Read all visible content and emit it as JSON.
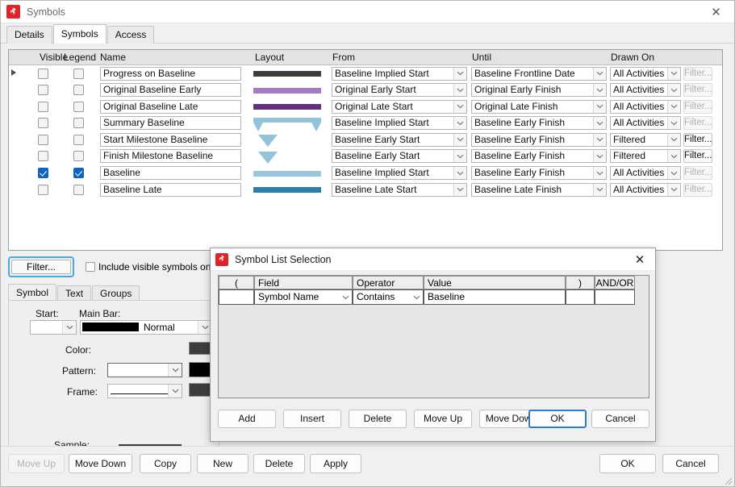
{
  "window": {
    "title": "Symbols",
    "icon": "app-logo-icon",
    "close_label": "✕",
    "tabs": [
      {
        "label": "Details",
        "active": false
      },
      {
        "label": "Symbols",
        "active": true
      },
      {
        "label": "Access",
        "active": false
      }
    ]
  },
  "grid": {
    "columns": [
      "Visible",
      "Legend",
      "Name",
      "Layout",
      "From",
      "Until",
      "Drawn On"
    ],
    "rows": [
      {
        "visible": false,
        "legend": false,
        "name": "Progress on Baseline",
        "layout": "bar-dark",
        "layout_color": "#3d3d3d",
        "from": "Baseline Implied Start",
        "until": "Baseline Frontline Date",
        "drawn_on": "All Activities",
        "filter_label": "Filter...",
        "filter_enabled": false,
        "selected": true
      },
      {
        "visible": false,
        "legend": false,
        "name": "Original Baseline Early",
        "layout": "bar-light-purple",
        "layout_color": "#a57cc4",
        "from": "Original Early Start",
        "until": "Original Early Finish",
        "drawn_on": "All Activities",
        "filter_label": "Filter...",
        "filter_enabled": false,
        "selected": false
      },
      {
        "visible": false,
        "legend": false,
        "name": "Original Baseline Late",
        "layout": "bar-purple",
        "layout_color": "#62307f",
        "from": "Original Late Start",
        "until": "Original Late Finish",
        "drawn_on": "All Activities",
        "filter_label": "Filter...",
        "filter_enabled": false,
        "selected": false
      },
      {
        "visible": false,
        "legend": false,
        "name": "Summary Baseline",
        "layout": "summary-bar",
        "layout_color": "#92c3da",
        "from": "Baseline Implied Start",
        "until": "Baseline Early Finish",
        "drawn_on": "All Activities",
        "filter_label": "Filter...",
        "filter_enabled": false,
        "selected": false
      },
      {
        "visible": false,
        "legend": false,
        "name": "Start Milestone Baseline",
        "layout": "triangle-down",
        "layout_color": "#92c3da",
        "from": "Baseline Early Start",
        "until": "Baseline Early Finish",
        "drawn_on": "Filtered",
        "filter_label": "Filter...",
        "filter_enabled": true,
        "selected": false
      },
      {
        "visible": false,
        "legend": false,
        "name": "Finish Milestone Baseline",
        "layout": "triangle-down",
        "layout_color": "#92c3da",
        "from": "Baseline Early Start",
        "until": "Baseline Early Finish",
        "drawn_on": "Filtered",
        "filter_label": "Filter...",
        "filter_enabled": true,
        "selected": false
      },
      {
        "visible": true,
        "legend": true,
        "name": "Baseline",
        "layout": "bar-steel-light",
        "layout_color": "#97c6dd",
        "from": "Baseline Implied Start",
        "until": "Baseline Early Finish",
        "drawn_on": "All Activities",
        "filter_label": "Filter...",
        "filter_enabled": false,
        "selected": false
      },
      {
        "visible": false,
        "legend": false,
        "name": "Baseline Late",
        "layout": "bar-steel-dark",
        "layout_color": "#2e7fae",
        "from": "Baseline Late Start",
        "until": "Baseline Late Finish",
        "drawn_on": "All Activities",
        "filter_label": "Filter...",
        "filter_enabled": false,
        "selected": false
      }
    ]
  },
  "filter_bar": {
    "filter_button": "Filter...",
    "include_visible_label": "Include visible symbols only",
    "include_visible_checked": false
  },
  "detail_tabs": [
    {
      "label": "Symbol",
      "active": true
    },
    {
      "label": "Text",
      "active": false
    },
    {
      "label": "Groups",
      "active": false
    }
  ],
  "symbol_tab": {
    "start_label": "Start:",
    "start_value": "",
    "main_bar_label": "Main Bar:",
    "main_bar_value": "Normal",
    "main_bar_swatch": "#000000",
    "color_label": "Color:",
    "color_swatch": "#3d3d3d",
    "pattern_label": "Pattern:",
    "pattern_value": "",
    "pattern_swatch": "#000000",
    "frame_label": "Frame:",
    "frame_value": "",
    "frame_swatch": "#3d3d3d",
    "sample_label": "Sample:",
    "sample_color": "#3d3d3d"
  },
  "modal": {
    "title": "Symbol List Selection",
    "icon": "app-logo-icon",
    "close_label": "✕",
    "columns": [
      "(",
      "Field",
      "Operator",
      "Value",
      ")",
      "AND/OR"
    ],
    "rows": [
      {
        "open_paren": "",
        "field": "Symbol Name",
        "operator": "Contains",
        "value": "Baseline",
        "close_paren": "",
        "andor": ""
      }
    ],
    "buttons": [
      {
        "label": "Add",
        "focus": false
      },
      {
        "label": "Insert",
        "focus": false
      },
      {
        "label": "Delete",
        "focus": false
      },
      {
        "label": "Move Up",
        "focus": false
      },
      {
        "label": "Move Down",
        "focus": false
      },
      {
        "label": "OK",
        "focus": true
      },
      {
        "label": "Cancel",
        "focus": false
      }
    ]
  },
  "footer": {
    "buttons": [
      {
        "label": "Move Up",
        "enabled": false
      },
      {
        "label": "Move Down",
        "enabled": true
      },
      {
        "label": "Copy",
        "enabled": true
      },
      {
        "label": "New",
        "enabled": true
      },
      {
        "label": "Delete",
        "enabled": true
      },
      {
        "label": "Apply",
        "enabled": true
      },
      {
        "label": "OK",
        "enabled": true
      },
      {
        "label": "Cancel",
        "enabled": true
      }
    ]
  },
  "colors": {
    "accent": "#0f62c0",
    "focus_ring": "#4aa8e0",
    "app_icon": "#e02229"
  }
}
